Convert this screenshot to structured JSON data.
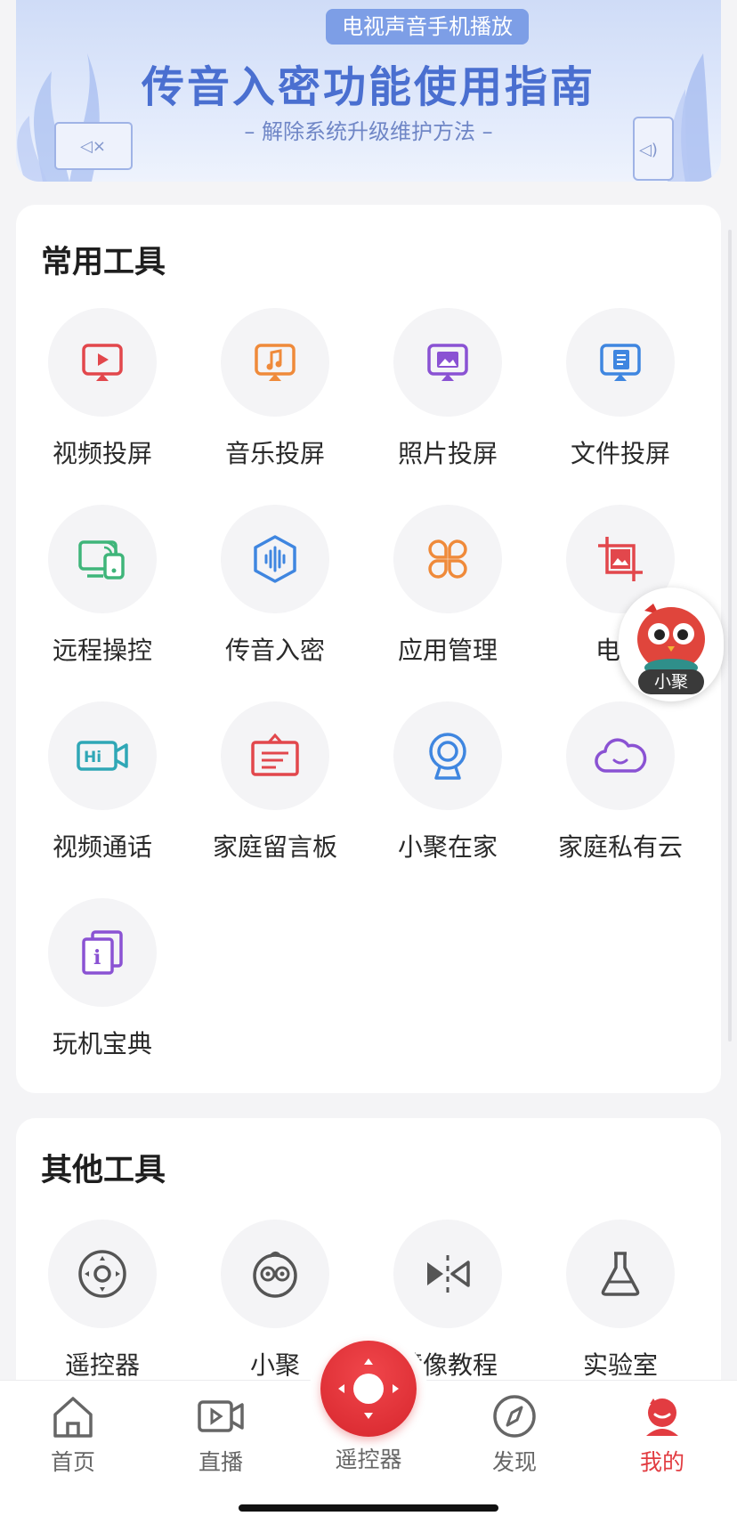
{
  "banner": {
    "tag": "电视声音手机播放",
    "title": "传音入密功能使用指南",
    "subtitle": "– 解除系统升级维护方法 –"
  },
  "common_tools": {
    "title": "常用工具",
    "items": [
      {
        "label": "视频投屏",
        "icon": "video-cast-icon",
        "color": "#e2474c"
      },
      {
        "label": "音乐投屏",
        "icon": "music-cast-icon",
        "color": "#ef8a3a"
      },
      {
        "label": "照片投屏",
        "icon": "photo-cast-icon",
        "color": "#8a52d3"
      },
      {
        "label": "文件投屏",
        "icon": "file-cast-icon",
        "color": "#3f86e0"
      },
      {
        "label": "远程操控",
        "icon": "remote-control-icon",
        "color": "#3fb57a"
      },
      {
        "label": "传音入密",
        "icon": "audio-wave-icon",
        "color": "#3f86e0"
      },
      {
        "label": "应用管理",
        "icon": "app-manage-icon",
        "color": "#ef8a3a"
      },
      {
        "label": "电视",
        "icon": "tv-screenshot-icon",
        "color": "#e2474c"
      },
      {
        "label": "视频通话",
        "icon": "video-call-icon",
        "color": "#2fa7b6"
      },
      {
        "label": "家庭留言板",
        "icon": "message-board-icon",
        "color": "#e2474c"
      },
      {
        "label": "小聚在家",
        "icon": "webcam-icon",
        "color": "#3f86e0"
      },
      {
        "label": "家庭私有云",
        "icon": "cloud-icon",
        "color": "#8a52d3"
      },
      {
        "label": "玩机宝典",
        "icon": "guide-book-icon",
        "color": "#8a52d3"
      }
    ]
  },
  "other_tools": {
    "title": "其他工具",
    "items": [
      {
        "label": "遥控器",
        "icon": "dpad-icon",
        "color": "#555555"
      },
      {
        "label": "小聚",
        "icon": "mascot-face-icon",
        "color": "#555555"
      },
      {
        "label": "镜像教程",
        "icon": "mirror-icon",
        "color": "#555555"
      },
      {
        "label": "实验室",
        "icon": "flask-icon",
        "color": "#555555"
      }
    ]
  },
  "mascot": {
    "label": "小聚"
  },
  "bottom_nav": {
    "items": [
      {
        "label": "首页",
        "icon": "home-icon"
      },
      {
        "label": "直播",
        "icon": "live-icon"
      },
      {
        "label": "遥控器",
        "icon": "remote-center-icon"
      },
      {
        "label": "发现",
        "icon": "compass-icon"
      },
      {
        "label": "我的",
        "icon": "profile-icon",
        "active": true
      }
    ]
  },
  "colors": {
    "accent": "#e23c41",
    "banner_blue": "#4a6fd0"
  }
}
